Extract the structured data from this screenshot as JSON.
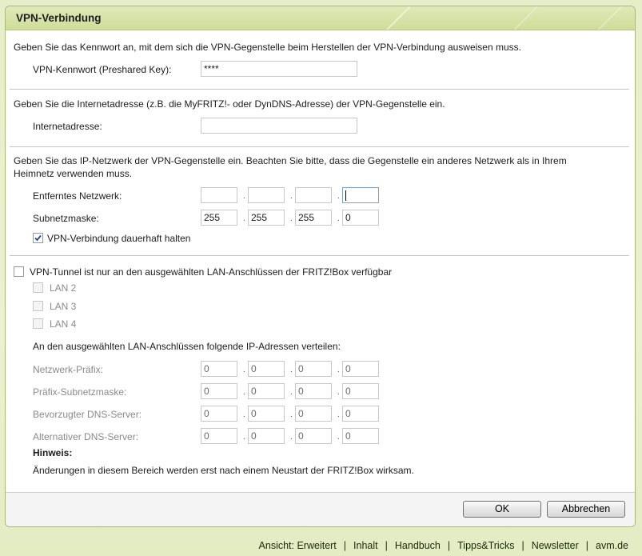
{
  "dialog": {
    "title": "VPN-Verbindung"
  },
  "section_key": {
    "text": "Geben Sie das Kennwort an, mit dem sich die VPN-Gegenstelle beim Herstellen der VPN-Verbindung ausweisen muss.",
    "label": "VPN-Kennwort (Preshared Key):",
    "value": "****"
  },
  "section_address": {
    "text": "Geben Sie die Internetadresse (z.B. die MyFRITZ!- oder DynDNS-Adresse) der VPN-Gegenstelle ein.",
    "label": "Internetadresse:",
    "value": ""
  },
  "section_network": {
    "text_line1": "Geben Sie das IP-Netzwerk der VPN-Gegenstelle ein. Beachten Sie bitte, dass die Gegenstelle ein anderes Netzwerk als in Ihrem",
    "text_line2": "Heimnetz verwenden muss.",
    "remote_network": {
      "label": "Entferntes Netzwerk:",
      "octets": [
        "",
        "",
        "",
        ""
      ]
    },
    "subnet_mask": {
      "label": "Subnetzmaske:",
      "octets": [
        "255",
        "255",
        "255",
        "0"
      ]
    },
    "keep_alive": {
      "label": "VPN-Verbindung dauerhaft halten",
      "checked": true
    }
  },
  "section_lan": {
    "tunnel_restrict": {
      "label": "VPN-Tunnel ist nur an den ausgewählten LAN-Anschlüssen der FRITZ!Box verfügbar",
      "checked": false
    },
    "ports": [
      {
        "label": "LAN 2",
        "checked": false
      },
      {
        "label": "LAN 3",
        "checked": false
      },
      {
        "label": "LAN 4",
        "checked": false
      }
    ],
    "distribute_text": "An den ausgewählten LAN-Anschlüssen folgende IP-Adressen verteilen:",
    "rows": [
      {
        "label": "Netzwerk-Präfix:",
        "octets": [
          "0",
          "0",
          "0",
          "0"
        ]
      },
      {
        "label": "Präfix-Subnetzmaske:",
        "octets": [
          "0",
          "0",
          "0",
          "0"
        ]
      },
      {
        "label": "Bevorzugter DNS-Server:",
        "octets": [
          "0",
          "0",
          "0",
          "0"
        ]
      },
      {
        "label": "Alternativer DNS-Server:",
        "octets": [
          "0",
          "0",
          "0",
          "0"
        ]
      }
    ],
    "hint_title": "Hinweis:",
    "hint_text": "Änderungen in diesem Bereich werden erst nach einem Neustart der FRITZ!Box wirksam."
  },
  "buttons": {
    "ok": "OK",
    "cancel": "Abbrechen"
  },
  "footer": {
    "links": [
      "Ansicht: Erweitert",
      "Inhalt",
      "Handbuch",
      "Tipps&Tricks",
      "Newsletter",
      "avm.de"
    ],
    "separator": "|"
  },
  "colors": {
    "header_bg": "#cfdd99",
    "page_bg": "#e6eec9",
    "panel_border": "#a9b77a",
    "footer_link": "#1c2a0c"
  }
}
